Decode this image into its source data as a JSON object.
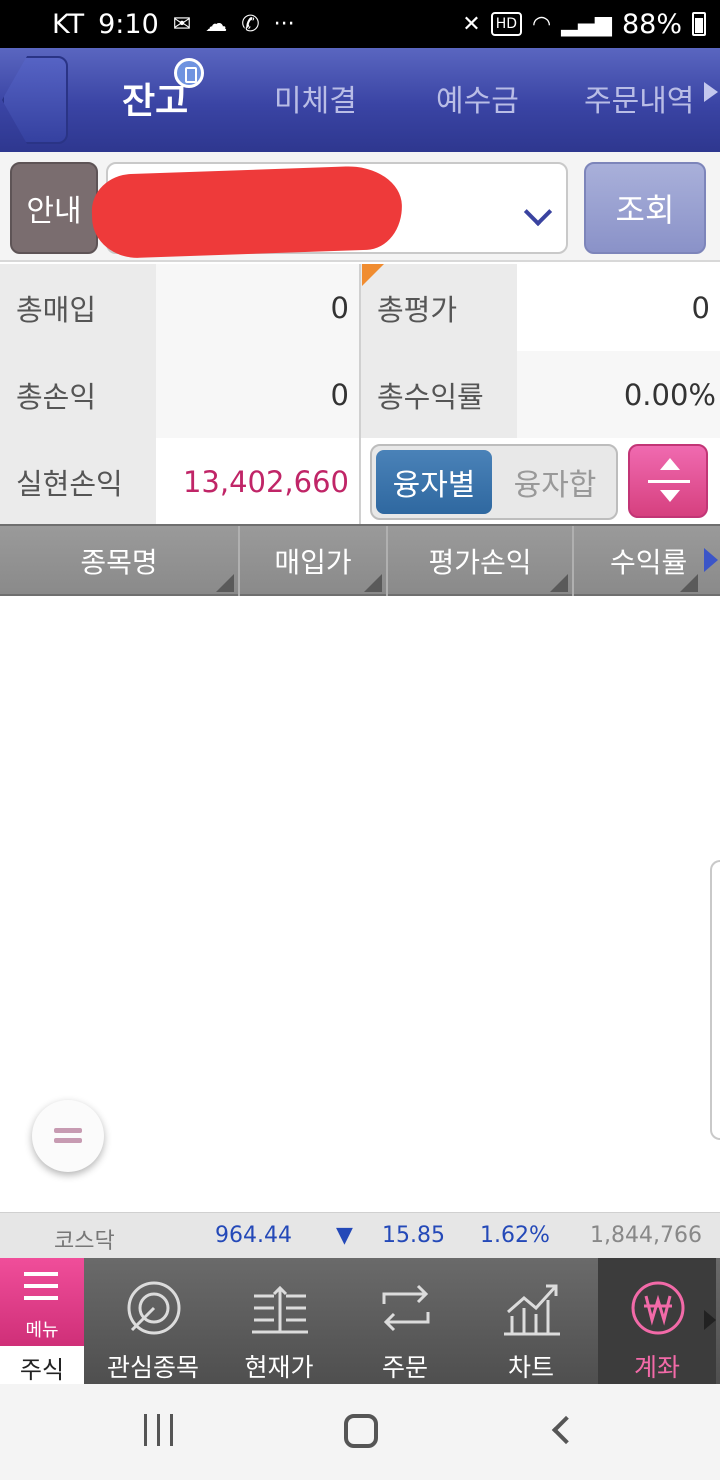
{
  "status_bar": {
    "carrier": "KT",
    "time": "9:10",
    "battery": "88%"
  },
  "tabs": {
    "items": [
      "잔고",
      "미체결",
      "예수금",
      "주문내역"
    ],
    "active_index": 0
  },
  "account_row": {
    "guide_label": "안내",
    "query_label": "조회"
  },
  "summary": {
    "total_purchase_label": "총매입",
    "total_purchase_value": "0",
    "total_eval_label": "총평가",
    "total_eval_value": "0",
    "total_pl_label": "총손익",
    "total_pl_value": "0",
    "total_return_label": "총수익률",
    "total_return_value": "0.00%",
    "realized_pl_label": "실현손익",
    "realized_pl_value": "13,402,660",
    "toggle_by_loan": "융자별",
    "toggle_loan_sum": "융자합"
  },
  "table": {
    "columns": [
      "종목명",
      "매입가",
      "평가손익",
      "수익률"
    ],
    "rows": []
  },
  "ticker": {
    "name": "코스닥",
    "index": "964.44",
    "direction_symbol": "▼",
    "change": "15.85",
    "change_pct": "1.62%",
    "volume": "1,844,766"
  },
  "bottom_nav": {
    "menu_label": "메뉴",
    "section_label": "주식",
    "items": [
      "관심종목",
      "현재가",
      "주문",
      "차트",
      "계좌"
    ],
    "active": "계좌"
  },
  "colors": {
    "header_blue": "#3a44a4",
    "accent_pink": "#d6407f",
    "realized_pink": "#c02567",
    "ticker_blue": "#2449b8"
  }
}
